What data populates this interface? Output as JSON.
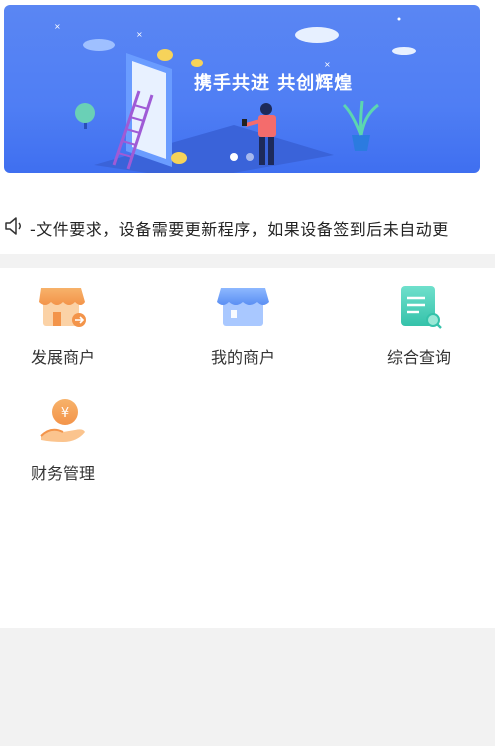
{
  "banner": {
    "title": "携手共进 共创辉煌",
    "dots": 2,
    "active_dot": 0
  },
  "notice": {
    "icon": "speaker-icon",
    "text": "-文件要求，设备需要更新程序，如果设备签到后未自动更"
  },
  "menu": {
    "items": [
      {
        "label": "发展商户",
        "icon": "develop-merchant-icon"
      },
      {
        "label": "我的商户",
        "icon": "my-merchant-icon"
      },
      {
        "label": "综合查询",
        "icon": "comprehensive-query-icon"
      },
      {
        "label": "财务管理",
        "icon": "finance-management-icon"
      }
    ]
  },
  "colors": {
    "banner_blue": "#4f7ef4",
    "orange": "#f5a25a",
    "blue": "#5b9af5",
    "teal": "#3ecbb4",
    "page_bg": "#f2f2f2"
  }
}
